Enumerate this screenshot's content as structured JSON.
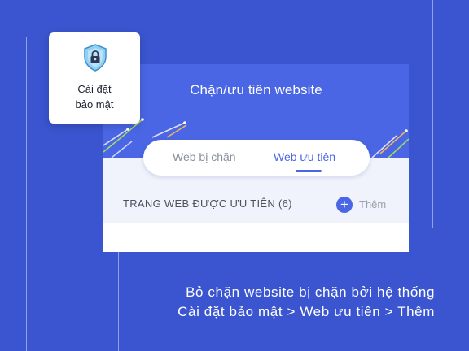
{
  "settings_shortcut": {
    "icon": "shield-lock-icon",
    "label_line1": "Cài đặt",
    "label_line2": "bảo mật"
  },
  "screen": {
    "title": "Chặn/ưu tiên website",
    "tabs": [
      {
        "label": "Web bị chặn",
        "active": false
      },
      {
        "label": "Web ưu tiên",
        "active": true
      }
    ],
    "section_label": "TRANG WEB ĐƯỢC ƯU TIÊN (6)",
    "add_label": "Thêm",
    "add_icon": "plus-icon"
  },
  "caption": {
    "line1": "Bỏ chặn website bị chặn bởi hệ thống",
    "line2": "Cài đặt bảo mật > Web ưu tiên > Thêm"
  },
  "colors": {
    "background": "#3a55cf",
    "header": "#4a66e4",
    "accent": "#4a66e4"
  }
}
